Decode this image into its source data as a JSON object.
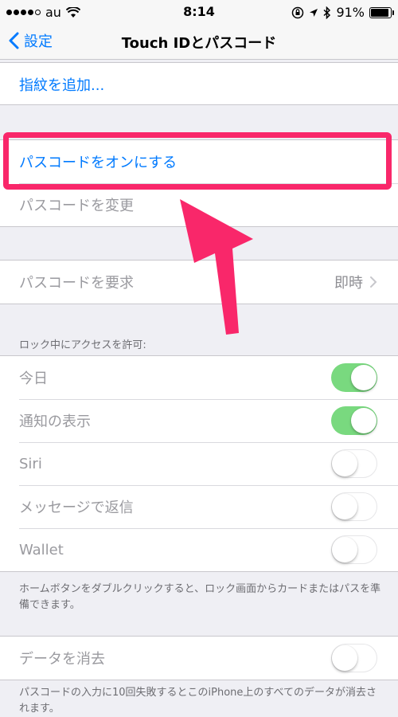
{
  "status_bar": {
    "carrier": "au",
    "time": "8:14",
    "battery": "91%",
    "battery_level": 0.91
  },
  "nav": {
    "back_label": "設定",
    "title": "Touch IDとパスコード"
  },
  "fingerprint": {
    "add_label": "指紋を追加..."
  },
  "passcode": {
    "turn_on_label": "パスコードをオンにする",
    "change_label": "パスコードを変更"
  },
  "require": {
    "label": "パスコードを要求",
    "value": "即時"
  },
  "lock_access": {
    "header": "ロック中にアクセスを許可:",
    "items": [
      {
        "label": "今日",
        "state": "on"
      },
      {
        "label": "通知の表示",
        "state": "on"
      },
      {
        "label": "Siri",
        "state": "off"
      },
      {
        "label": "メッセージで返信",
        "state": "off"
      },
      {
        "label": "Wallet",
        "state": "off"
      }
    ],
    "footer": "ホームボタンをダブルクリックすると、ロック画面からカードまたはパスを準備できます。"
  },
  "erase": {
    "label": "データを消去",
    "state": "off",
    "footer": "パスコードの入力に10回失敗するとこのiPhone上のすべてのデータが消去されます。"
  },
  "colors": {
    "accent": "#007aff",
    "toggle_on": "#79d97f",
    "annotation": "#f9276a"
  }
}
